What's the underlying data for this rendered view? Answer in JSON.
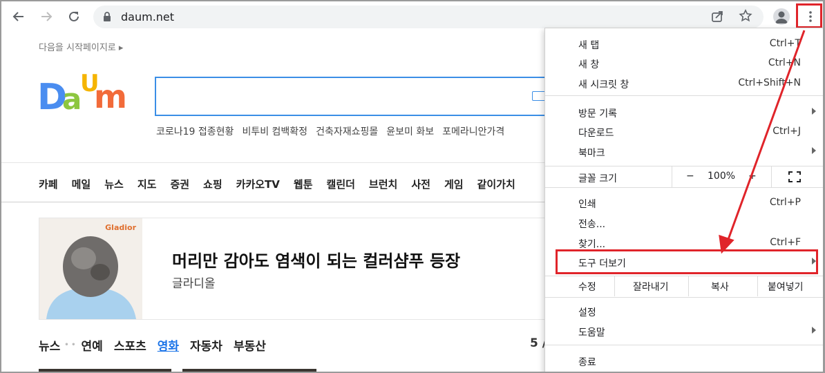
{
  "browser": {
    "url": "daum.net",
    "icons": [
      "back-arrow-icon",
      "forward-arrow-icon",
      "reload-icon",
      "lock-icon",
      "share-icon",
      "star-icon",
      "profile-icon",
      "kebab-menu-icon"
    ]
  },
  "page": {
    "home_link": "다음을 시작페이지로 ▸",
    "logo_letters": [
      "D",
      "a",
      "U",
      "m"
    ],
    "trends": [
      "코로나19 접종현황",
      "비투비 컴백확정",
      "건축자재쇼핑몰",
      "윤보미 화보",
      "포메라니안가격"
    ],
    "gnb": [
      "카페",
      "메일",
      "뉴스",
      "지도",
      "증권",
      "쇼핑",
      "카카오TV",
      "웹툰",
      "캘린더",
      "브런치",
      "사전",
      "게임",
      "같이가치"
    ],
    "ad": {
      "brand": "Gladior",
      "title": "머리만 감아도 염색이 되는 컬러샴푸 등장",
      "subtitle": "글라디올"
    },
    "news_tabs": [
      "뉴스",
      "연예",
      "스포츠",
      "영화",
      "자동차",
      "부동산"
    ],
    "news_tab_separator": "• •",
    "active_news_tab": "영화",
    "pager": "5 /"
  },
  "menu": {
    "items": [
      {
        "label": "새 탭",
        "shortcut": "Ctrl+T"
      },
      {
        "label": "새 창",
        "shortcut": "Ctrl+N"
      },
      {
        "label": "새 시크릿 창",
        "shortcut": "Ctrl+Shift+N"
      },
      {
        "label": "방문 기록",
        "shortcut": ""
      },
      {
        "label": "다운로드",
        "shortcut": "Ctrl+J"
      },
      {
        "label": "북마크",
        "shortcut": ""
      },
      {
        "label": "인쇄",
        "shortcut": "Ctrl+P"
      },
      {
        "label": "전송...",
        "shortcut": ""
      },
      {
        "label": "찾기...",
        "shortcut": "Ctrl+F"
      },
      {
        "label": "도구 더보기",
        "shortcut": ""
      },
      {
        "label": "설정",
        "shortcut": ""
      },
      {
        "label": "도움말",
        "shortcut": ""
      },
      {
        "label": "종료",
        "shortcut": ""
      }
    ],
    "zoom": {
      "label": "글꼴 크기",
      "minus": "−",
      "value": "100%",
      "plus": "+"
    },
    "edit": {
      "label": "수정",
      "cut": "잘라내기",
      "copy": "복사",
      "paste": "붙여넣기"
    }
  },
  "annotation_color": "#e0242a"
}
